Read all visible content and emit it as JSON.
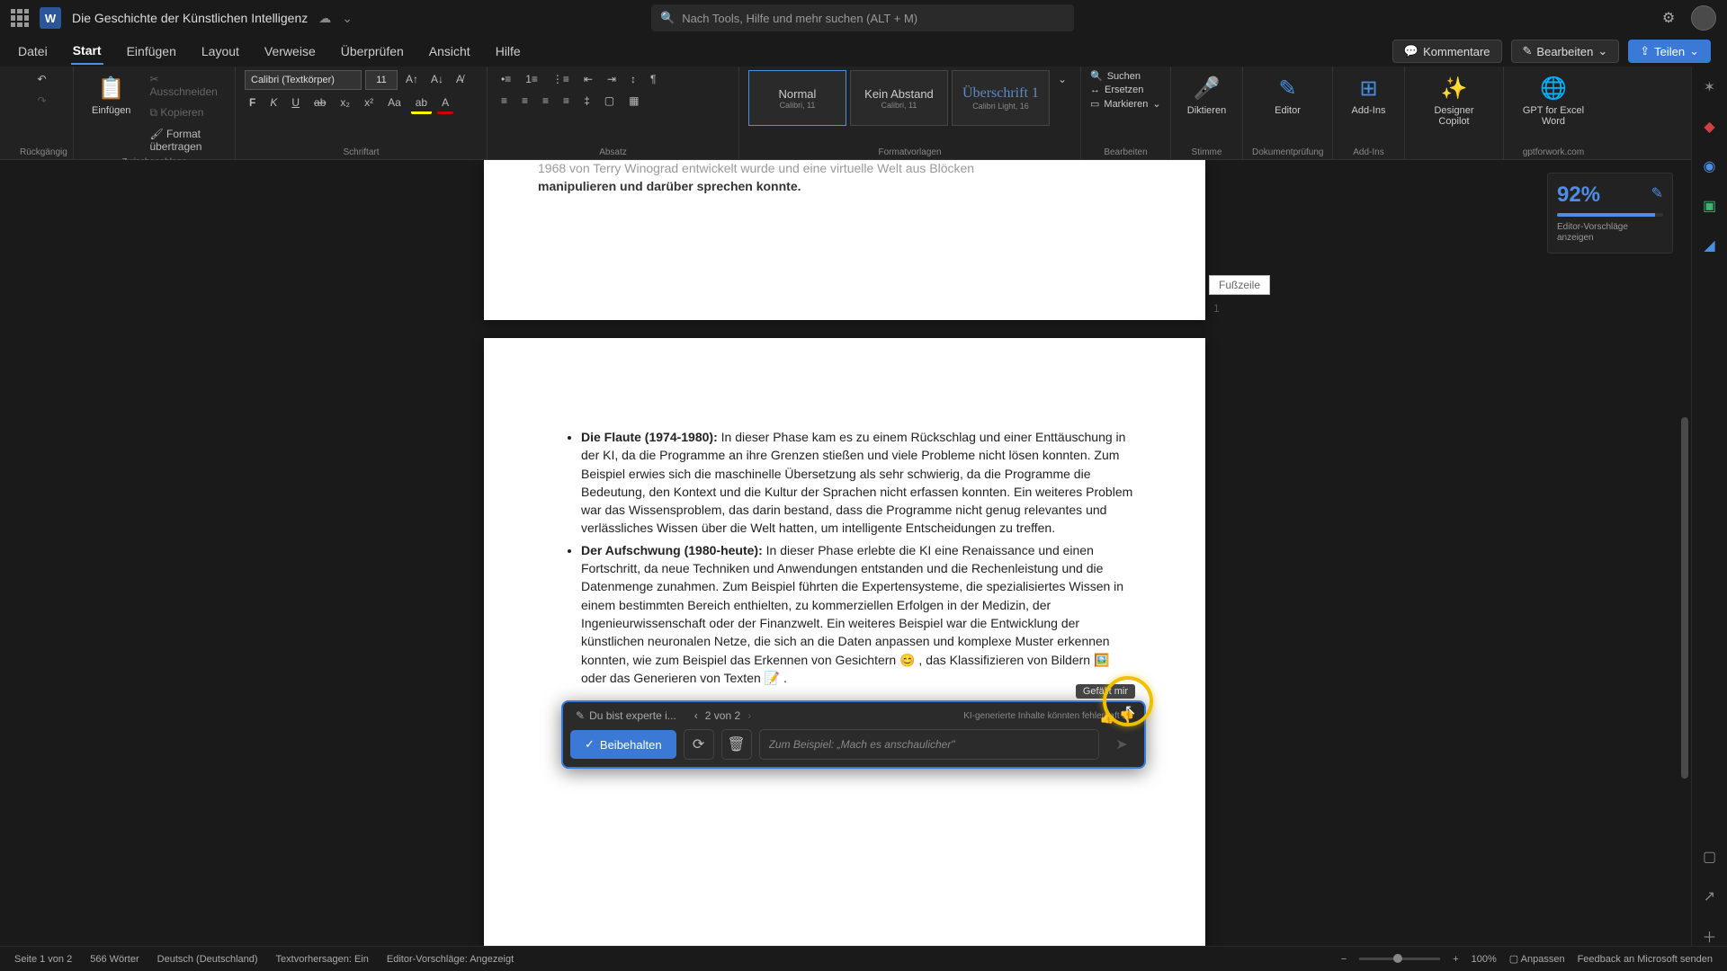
{
  "titlebar": {
    "doc_title": "Die Geschichte der Künstlichen Intelligenz",
    "search_placeholder": "Nach Tools, Hilfe und mehr suchen (ALT + M)"
  },
  "tabs": {
    "items": [
      "Datei",
      "Start",
      "Einfügen",
      "Layout",
      "Verweise",
      "Überprüfen",
      "Ansicht",
      "Hilfe"
    ],
    "active_index": 1,
    "comments": "Kommentare",
    "edit": "Bearbeiten",
    "share": "Teilen"
  },
  "ribbon": {
    "undo_label": "Rückgängig",
    "clipboard": {
      "paste": "Einfügen",
      "cut": "Ausschneiden",
      "copy": "Kopieren",
      "format_painter": "Format übertragen",
      "group": "Zwischenablage"
    },
    "font": {
      "name": "Calibri (Textkörper)",
      "size": "11",
      "group": "Schriftart"
    },
    "paragraph": {
      "group": "Absatz"
    },
    "styles": {
      "items": [
        {
          "name": "Normal",
          "sub": "Calibri, 11"
        },
        {
          "name": "Kein Abstand",
          "sub": "Calibri, 11"
        },
        {
          "name": "Überschrift 1",
          "sub": "Calibri Light, 16"
        }
      ],
      "group": "Formatvorlagen"
    },
    "editing": {
      "find": "Suchen",
      "replace": "Ersetzen",
      "select": "Markieren",
      "group": "Bearbeiten"
    },
    "dictate": {
      "label": "Diktieren",
      "group": "Stimme"
    },
    "editor": {
      "label": "Editor",
      "group": "Dokumentprüfung"
    },
    "addins": {
      "label": "Add-Ins",
      "group": "Add-Ins"
    },
    "designer": {
      "label": "Designer Copilot"
    },
    "gpt": {
      "label": "GPT for Excel Word",
      "group": "gptforwork.com"
    }
  },
  "document": {
    "page1_fragment": "manipulieren und darüber sprechen konnte.",
    "page1_line_above": "1968 von Terry Winograd entwickelt wurde und eine virtuelle Welt aus Blöcken",
    "footer_label": "Fußzeile",
    "page1_number": "1",
    "bullets": [
      {
        "title": "Die Flaute (1974-1980):",
        "body": " In dieser Phase kam es zu einem Rückschlag und einer Enttäuschung in der KI, da die Programme an ihre Grenzen stießen und viele Probleme nicht lösen konnten. Zum Beispiel erwies sich die maschinelle Übersetzung als sehr schwierig, da die Programme die Bedeutung, den Kontext und die Kultur der Sprachen nicht erfassen konnten. Ein weiteres Problem war das Wissensproblem, das darin bestand, dass die Programme nicht genug relevantes und verlässliches Wissen über die Welt hatten, um intelligente Entscheidungen zu treffen."
      },
      {
        "title": "Der Aufschwung (1980-heute):",
        "body_part1": " In dieser Phase erlebte die KI eine Renaissance und einen Fortschritt, da neue Techniken und Anwendungen entstanden und die Rechenleistung und die Datenmenge zunahmen. Zum Beispiel führten die Expertensysteme, die spezialisiertes Wissen in einem bestimmten Bereich enthielten, zu kommerziellen Erfolgen in der Medizin, der Ingenieurwissenschaft oder der Finanzwelt. Ein weiteres Beispiel war die Entwicklung der künstlichen neuronalen Netze, die sich an die Daten anpassen und komplexe Muster erkennen konnten, wie zum Beispiel das Erkennen von Gesichtern ",
        "emoji1": "😊",
        "body_part2": " , das Klassifizieren von Bildern ",
        "emoji2": "🖼️",
        "body_part3": " oder das Generieren von Texten ",
        "emoji3": "📝",
        "body_part4": " ."
      }
    ]
  },
  "copilot": {
    "prompt_preview": "Du bist experte i...",
    "counter": "2 von 2",
    "disclaimer": "KI-generierte Inhalte könnten fehlerhaft se",
    "tooltip": "Gefällt mir",
    "keep": "Beibehalten",
    "input_placeholder": "Zum Beispiel: „Mach es anschaulicher\""
  },
  "score": {
    "value": "92%",
    "label": "Editor-Vorschläge anzeigen"
  },
  "statusbar": {
    "page": "Seite 1 von 2",
    "words": "566 Wörter",
    "lang": "Deutsch (Deutschland)",
    "predictions": "Textvorhersagen: Ein",
    "editor_sugg": "Editor-Vorschläge: Angezeigt",
    "zoom": "100%",
    "fit": "Anpassen",
    "feedback": "Feedback an Microsoft senden"
  }
}
